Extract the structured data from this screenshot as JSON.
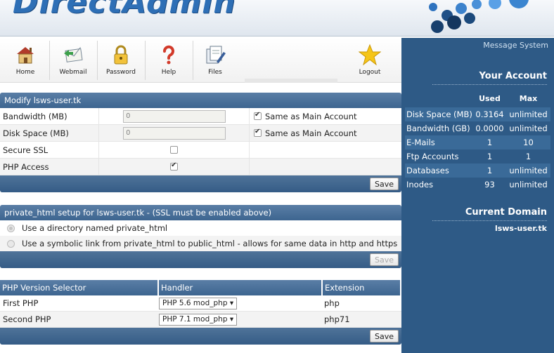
{
  "header": {
    "logo": "DirectAdmin"
  },
  "toolbar": {
    "items": [
      {
        "label": "Home",
        "icon": "house-icon"
      },
      {
        "label": "Webmail",
        "icon": "mail-icon"
      },
      {
        "label": "Password",
        "icon": "padlock-icon"
      },
      {
        "label": "Help",
        "icon": "question-mark-icon"
      },
      {
        "label": "Files",
        "icon": "files-icon"
      },
      {
        "label": "Logout",
        "icon": "star-icon"
      }
    ]
  },
  "panel": {
    "message_system": "Message System",
    "your_account": "Your Account",
    "col_used": "Used",
    "col_max": "Max",
    "rows": [
      {
        "label": "Disk Space (MB)",
        "used": "0.3164",
        "max": "unlimited"
      },
      {
        "label": "Bandwidth (GB)",
        "used": "0.0000",
        "max": "unlimited"
      },
      {
        "label": "E-Mails",
        "used": "1",
        "max": "10"
      },
      {
        "label": "Ftp Accounts",
        "used": "1",
        "max": "1"
      },
      {
        "label": "Databases",
        "used": "1",
        "max": "unlimited"
      },
      {
        "label": "Inodes",
        "used": "93",
        "max": "unlimited"
      }
    ],
    "current_domain_title": "Current Domain",
    "current_domain": "lsws-user.tk"
  },
  "modify": {
    "title": "Modify lsws-user.tk",
    "bandwidth_label": "Bandwidth (MB)",
    "bandwidth_value": "0",
    "disk_label": "Disk Space (MB)",
    "disk_value": "0",
    "same_as_main": "Same as Main Account",
    "ssl_label": "Secure SSL",
    "php_label": "PHP Access",
    "save": "Save"
  },
  "private_html": {
    "title": "private_html setup for lsws-user.tk - (SSL must be enabled above)",
    "option1": "Use a directory named private_html",
    "option2": "Use a symbolic link from private_html to public_html - allows for same data in http and https",
    "save": "Save"
  },
  "php": {
    "col_selector": "PHP Version Selector",
    "col_handler": "Handler",
    "col_extension": "Extension",
    "rows": [
      {
        "label": "First PHP",
        "handler": "PHP 5.6 mod_php",
        "extension": "php"
      },
      {
        "label": "Second PHP",
        "handler": "PHP 7.1 mod_php",
        "extension": "php71"
      }
    ],
    "save": "Save"
  }
}
